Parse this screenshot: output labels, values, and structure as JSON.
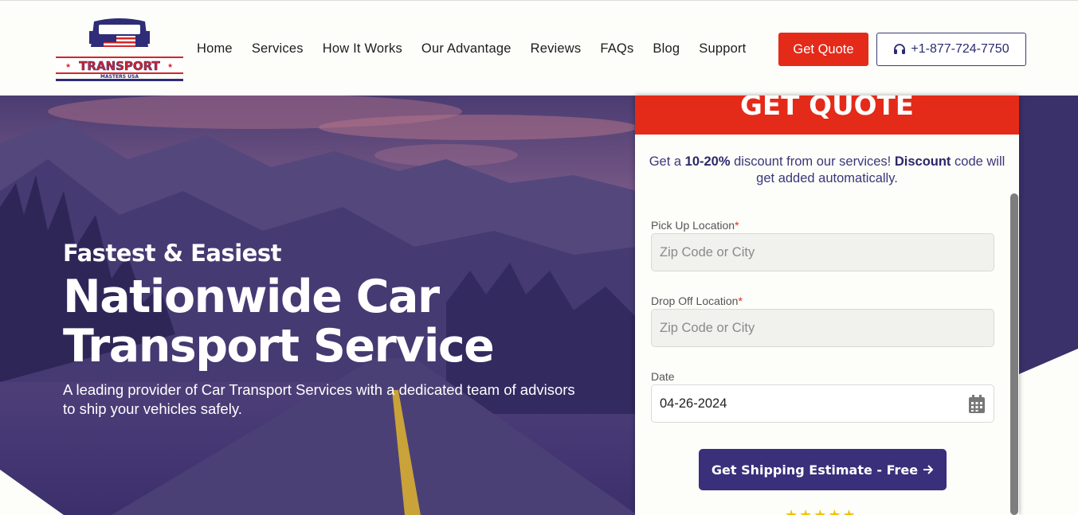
{
  "header": {
    "logo_text": "TRANSPORT",
    "logo_subtext": "MASTERS USA",
    "nav": [
      "Home",
      "Services",
      "How It Works",
      "Our Advantage",
      "Reviews",
      "FAQs",
      "Blog",
      "Support"
    ],
    "quote_label": "Get Quote",
    "phone": "+1-877-724-7750"
  },
  "hero": {
    "kicker": "Fastest & Easiest",
    "headline_line1": "Nationwide Car",
    "headline_line2": "Transport Service",
    "subtitle": "A leading provider of Car Transport Services with a dedicated team of advisors to ship your vehicles safely."
  },
  "form": {
    "title": "GET QUOTE",
    "promo_pre": "Get a ",
    "promo_discount": "10-20%",
    "promo_mid": " discount from our services! ",
    "promo_bold": "Discount",
    "promo_post": " code will get added automatically.",
    "pickup_label": "Pick Up Location",
    "pickup_placeholder": "Zip Code or City",
    "dropoff_label": "Drop Off Location",
    "dropoff_placeholder": "Zip Code or City",
    "date_label": "Date",
    "date_value": "04-26-2024",
    "required_mark": "*",
    "submit_label": "Get Shipping Estimate - Free",
    "stars": "★★★★★"
  },
  "colors": {
    "accent_red": "#e42a18",
    "brand_purple": "#3a2f7a"
  }
}
